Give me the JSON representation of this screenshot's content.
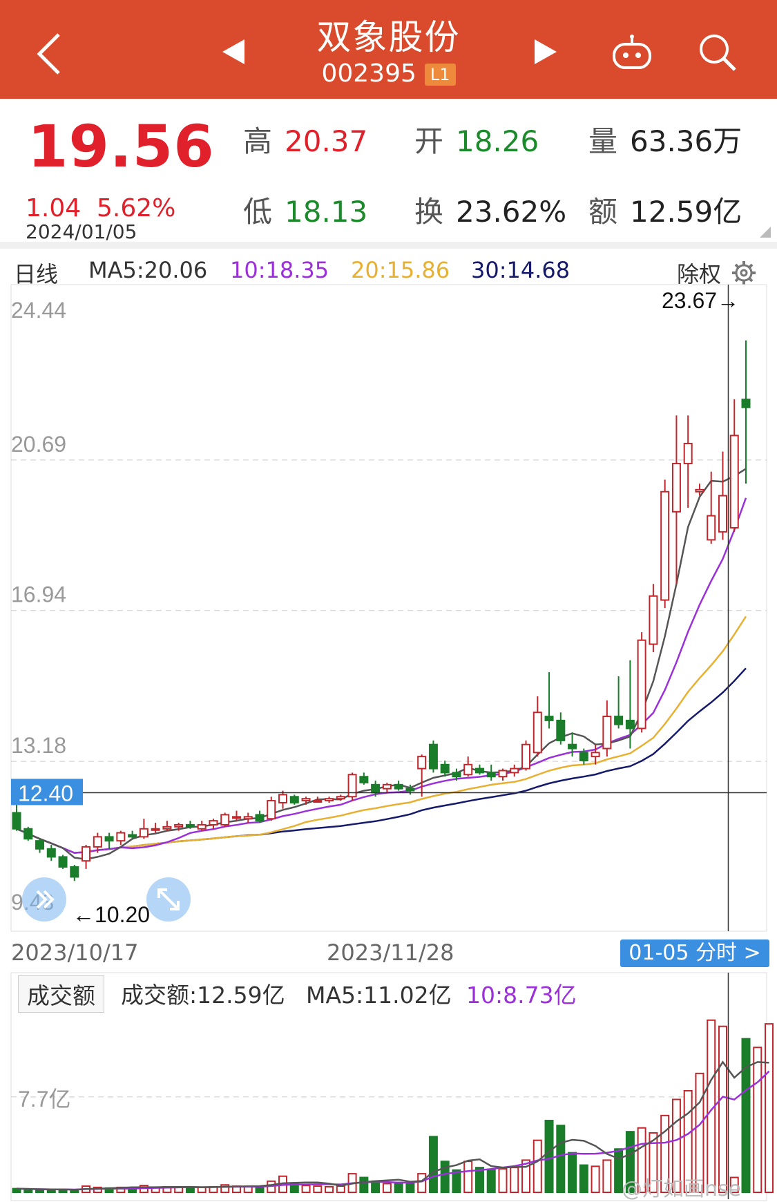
{
  "header": {
    "back_icon": "chevron-left-icon",
    "prev_icon": "triangle-left-icon",
    "next_icon": "triangle-right-icon",
    "robot_icon": "robot-icon",
    "search_icon": "search-icon",
    "title": "双象股份",
    "code": "002395",
    "badge": "L1"
  },
  "quote": {
    "price": "19.56",
    "change": "1.04",
    "change_pct": "5.62%",
    "date": "2024/01/05",
    "high_label": "高",
    "high": "20.37",
    "open_label": "开",
    "open": "18.26",
    "vol_label": "量",
    "vol": "63.36万",
    "low_label": "低",
    "low": "18.13",
    "turn_label": "换",
    "turn": "23.62%",
    "amt_label": "额",
    "amt": "12.59亿"
  },
  "ma_bar": {
    "period": "日线",
    "ma5": "MA5:20.06",
    "ma10": "10:18.35",
    "ma20": "20:15.86",
    "ma30": "30:14.68",
    "fq": "除权",
    "settings_icon": "gear-icon"
  },
  "colors": {
    "up": "#c0262b",
    "down": "#1a7d2a",
    "ma5": "#555555",
    "ma10": "#9b30d9",
    "ma20": "#e8b030",
    "ma30": "#14196b"
  },
  "chart_data": {
    "type": "candlestick",
    "y_ticks": [
      "24.44",
      "20.69",
      "16.94",
      "13.18",
      "9.43"
    ],
    "ylim": [
      9.43,
      24.44
    ],
    "crosshair_price": "12.40",
    "max_label": "23.67→",
    "min_label": "←10.20",
    "x_labels": [
      "2023/10/17",
      "2023/11/28"
    ],
    "candles": [
      [
        11.9,
        12.1,
        11.45,
        11.5
      ],
      [
        11.5,
        11.55,
        11.2,
        11.25
      ],
      [
        11.2,
        11.25,
        10.9,
        11.0
      ],
      [
        11.0,
        11.1,
        10.7,
        10.8
      ],
      [
        10.8,
        10.85,
        10.5,
        10.55
      ],
      [
        10.55,
        10.6,
        10.2,
        10.3
      ],
      [
        10.7,
        11.1,
        10.5,
        11.05
      ],
      [
        11.05,
        11.4,
        10.9,
        11.3
      ],
      [
        11.3,
        11.4,
        11.0,
        11.2
      ],
      [
        11.2,
        11.45,
        11.1,
        11.4
      ],
      [
        11.35,
        11.45,
        11.25,
        11.3
      ],
      [
        11.3,
        11.75,
        11.25,
        11.5
      ],
      [
        11.5,
        11.65,
        11.4,
        11.5
      ],
      [
        11.5,
        11.7,
        11.45,
        11.55
      ],
      [
        11.55,
        11.65,
        11.45,
        11.6
      ],
      [
        11.6,
        11.7,
        11.5,
        11.55
      ],
      [
        11.5,
        11.7,
        11.45,
        11.6
      ],
      [
        11.6,
        11.75,
        11.5,
        11.7
      ],
      [
        11.6,
        11.9,
        11.55,
        11.85
      ],
      [
        11.8,
        11.95,
        11.7,
        11.8
      ],
      [
        11.75,
        11.9,
        11.65,
        11.8
      ],
      [
        11.85,
        11.95,
        11.65,
        11.7
      ],
      [
        11.75,
        12.3,
        11.7,
        12.2
      ],
      [
        12.15,
        12.45,
        12.0,
        12.35
      ],
      [
        12.3,
        12.35,
        12.1,
        12.15
      ],
      [
        12.2,
        12.3,
        12.1,
        12.25
      ],
      [
        12.2,
        12.3,
        12.15,
        12.2
      ],
      [
        12.2,
        12.3,
        12.15,
        12.25
      ],
      [
        12.25,
        12.35,
        12.2,
        12.3
      ],
      [
        12.3,
        12.9,
        12.2,
        12.85
      ],
      [
        12.8,
        12.9,
        12.6,
        12.65
      ],
      [
        12.6,
        12.7,
        12.3,
        12.4
      ],
      [
        12.5,
        12.65,
        12.4,
        12.6
      ],
      [
        12.6,
        12.7,
        12.45,
        12.5
      ],
      [
        12.5,
        12.6,
        12.35,
        12.45
      ],
      [
        13.0,
        13.35,
        12.3,
        13.3
      ],
      [
        13.6,
        13.7,
        12.9,
        13.0
      ],
      [
        13.1,
        13.2,
        12.8,
        12.9
      ],
      [
        12.9,
        13.0,
        12.7,
        12.8
      ],
      [
        12.85,
        13.3,
        12.8,
        13.1
      ],
      [
        13.0,
        13.1,
        12.85,
        12.9
      ],
      [
        12.9,
        13.1,
        12.7,
        12.8
      ],
      [
        12.8,
        13.0,
        12.7,
        12.95
      ],
      [
        12.9,
        13.1,
        12.8,
        13.0
      ],
      [
        13.0,
        13.7,
        12.95,
        13.6
      ],
      [
        13.4,
        14.8,
        13.3,
        14.4
      ],
      [
        14.3,
        15.4,
        14.0,
        14.2
      ],
      [
        14.2,
        14.4,
        13.6,
        13.7
      ],
      [
        13.6,
        13.9,
        13.3,
        13.5
      ],
      [
        13.4,
        13.5,
        13.1,
        13.2
      ],
      [
        13.3,
        13.6,
        13.1,
        13.4
      ],
      [
        13.5,
        14.7,
        13.3,
        14.3
      ],
      [
        14.3,
        15.3,
        14.0,
        14.1
      ],
      [
        14.2,
        15.7,
        13.5,
        14.0
      ],
      [
        14.0,
        16.4,
        13.9,
        16.2
      ],
      [
        16.1,
        17.6,
        15.9,
        17.3
      ],
      [
        17.2,
        20.2,
        17.0,
        19.9
      ],
      [
        19.4,
        21.8,
        17.6,
        20.6
      ],
      [
        20.6,
        21.8,
        19.5,
        21.1
      ],
      [
        19.9,
        20.1,
        19.8,
        19.95
      ],
      [
        18.7,
        20.4,
        18.6,
        19.3
      ],
      [
        18.9,
        20.9,
        18.7,
        19.8
      ],
      [
        19.0,
        22.2,
        18.9,
        21.3
      ],
      [
        22.2,
        23.67,
        20.1,
        22.0
      ]
    ]
  },
  "nav": {
    "date_left": "2023/10/17",
    "date_mid": "2023/11/28",
    "fenshi": "01-05 分时 >"
  },
  "volume": {
    "btn": "成交额",
    "amt": "成交额:12.59亿",
    "ma5": "MA5:11.02亿",
    "ma10": "10:8.73亿",
    "y_tick": "7.7亿",
    "bars": [
      0.3,
      0.25,
      0.2,
      0.2,
      0.22,
      0.18,
      0.5,
      0.4,
      0.35,
      0.4,
      0.35,
      0.55,
      0.4,
      0.45,
      0.4,
      0.4,
      0.42,
      0.45,
      0.6,
      0.5,
      0.45,
      0.5,
      0.9,
      1.3,
      0.7,
      0.55,
      0.5,
      0.45,
      0.5,
      1.5,
      1.2,
      0.9,
      0.7,
      0.8,
      0.7,
      1.5,
      4.5,
      2.5,
      1.8,
      2.5,
      2.0,
      1.8,
      1.9,
      2.0,
      2.6,
      4.2,
      5.8,
      5.4,
      3.2,
      2.2,
      2.1,
      2.6,
      3.5,
      4.9,
      5.2,
      4.8,
      6.2,
      7.5,
      8.2,
      9.6,
      13.9,
      13.4,
      1.2,
      12.4,
      11.7,
      13.6
    ]
  },
  "overlay": {
    "expand_icon": "expand-arrows-icon",
    "collapse_icon": "double-chevron-icon"
  },
  "watermark": "@灯如画nse"
}
